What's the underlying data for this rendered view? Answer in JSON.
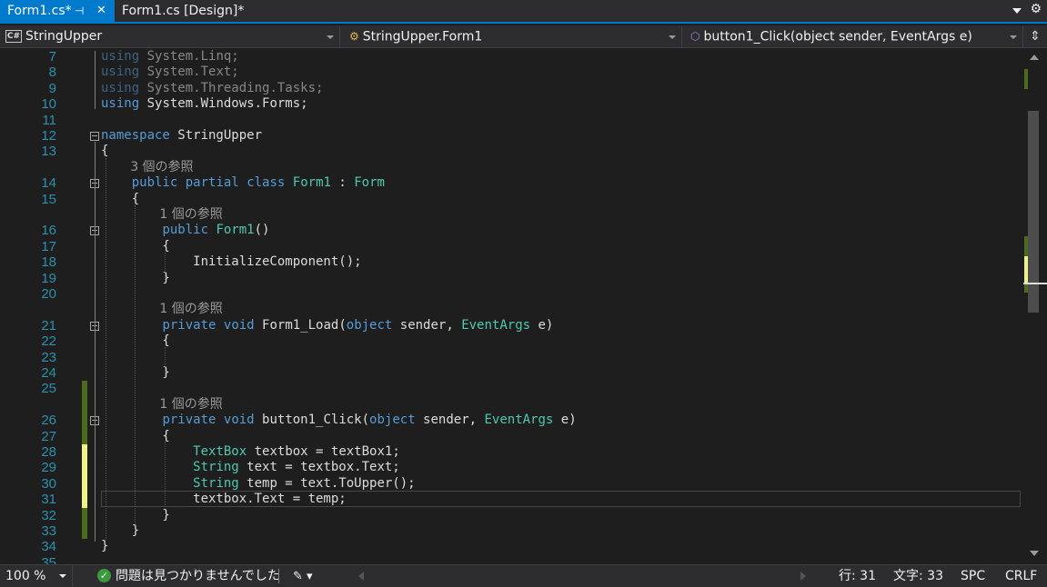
{
  "tabs": [
    {
      "label": "Form1.cs*",
      "active": true
    },
    {
      "label": "Form1.cs [Design]*",
      "active": false
    }
  ],
  "tab_icons": {
    "pin": "pin-icon",
    "close": "close-icon",
    "menu": "chevron-down-icon",
    "settings": "gear-icon"
  },
  "navbar": {
    "project": "StringUpper",
    "project_icon_text": "C#",
    "type": "StringUpper.Form1",
    "member": "button1_Click(object sender, EventArgs e)"
  },
  "editor": {
    "lines": [
      {
        "n": "7",
        "tokens": [
          [
            "kw",
            "using"
          ],
          [
            "tx",
            " System.Linq;"
          ]
        ],
        "dim": true
      },
      {
        "n": "8",
        "tokens": [
          [
            "kw",
            "using"
          ],
          [
            "tx",
            " System.Text;"
          ]
        ],
        "dim": true
      },
      {
        "n": "9",
        "tokens": [
          [
            "kw",
            "using"
          ],
          [
            "tx",
            " System.Threading.Tasks;"
          ]
        ],
        "dim": true
      },
      {
        "n": "10",
        "tokens": [
          [
            "kw",
            "using"
          ],
          [
            "tx",
            " System.Windows.Forms;"
          ]
        ]
      },
      {
        "n": "11",
        "tokens": []
      },
      {
        "n": "12",
        "tokens": [
          [
            "kw",
            "namespace"
          ],
          [
            "tx",
            " StringUpper"
          ]
        ],
        "fold": true
      },
      {
        "n": "13",
        "tokens": [
          [
            "tx",
            "{"
          ]
        ]
      },
      {
        "lens": "3 個の参照",
        "indent": 4
      },
      {
        "n": "14",
        "tokens": [
          [
            "tx",
            "    "
          ],
          [
            "kw",
            "public"
          ],
          [
            "tx",
            " "
          ],
          [
            "kw",
            "partial"
          ],
          [
            "tx",
            " "
          ],
          [
            "kw",
            "class"
          ],
          [
            "tx",
            " "
          ],
          [
            "ty",
            "Form1"
          ],
          [
            "tx",
            " : "
          ],
          [
            "ty",
            "Form"
          ]
        ],
        "fold": true
      },
      {
        "n": "15",
        "tokens": [
          [
            "tx",
            "    {"
          ]
        ]
      },
      {
        "lens": "1 個の参照",
        "indent": 8
      },
      {
        "n": "16",
        "tokens": [
          [
            "tx",
            "        "
          ],
          [
            "kw",
            "public"
          ],
          [
            "tx",
            " "
          ],
          [
            "ty",
            "Form1"
          ],
          [
            "tx",
            "()"
          ]
        ],
        "fold": true
      },
      {
        "n": "17",
        "tokens": [
          [
            "tx",
            "        {"
          ]
        ]
      },
      {
        "n": "18",
        "tokens": [
          [
            "tx",
            "            InitializeComponent();"
          ]
        ]
      },
      {
        "n": "19",
        "tokens": [
          [
            "tx",
            "        }"
          ]
        ]
      },
      {
        "n": "20",
        "tokens": []
      },
      {
        "lens": "1 個の参照",
        "indent": 8
      },
      {
        "n": "21",
        "tokens": [
          [
            "tx",
            "        "
          ],
          [
            "kw",
            "private"
          ],
          [
            "tx",
            " "
          ],
          [
            "kw",
            "void"
          ],
          [
            "tx",
            " Form1_Load("
          ],
          [
            "kw",
            "object"
          ],
          [
            "tx",
            " sender, "
          ],
          [
            "ty",
            "EventArgs"
          ],
          [
            "tx",
            " e)"
          ]
        ],
        "fold": true
      },
      {
        "n": "22",
        "tokens": [
          [
            "tx",
            "        {"
          ]
        ]
      },
      {
        "n": "23",
        "tokens": []
      },
      {
        "n": "24",
        "tokens": [
          [
            "tx",
            "        }"
          ]
        ]
      },
      {
        "n": "25",
        "tokens": [],
        "change": "green"
      },
      {
        "lens": "1 個の参照",
        "indent": 8,
        "change": "green"
      },
      {
        "n": "26",
        "tokens": [
          [
            "tx",
            "        "
          ],
          [
            "kw",
            "private"
          ],
          [
            "tx",
            " "
          ],
          [
            "kw",
            "void"
          ],
          [
            "tx",
            " button1_Click("
          ],
          [
            "kw",
            "object"
          ],
          [
            "tx",
            " sender, "
          ],
          [
            "ty",
            "EventArgs"
          ],
          [
            "tx",
            " e)"
          ]
        ],
        "fold": true,
        "change": "green"
      },
      {
        "n": "27",
        "tokens": [
          [
            "tx",
            "        {"
          ]
        ],
        "change": "green"
      },
      {
        "n": "28",
        "tokens": [
          [
            "tx",
            "            "
          ],
          [
            "ty",
            "TextBox"
          ],
          [
            "tx",
            " textbox = textBox1;"
          ]
        ],
        "change": "yellow"
      },
      {
        "n": "29",
        "tokens": [
          [
            "tx",
            "            "
          ],
          [
            "ty",
            "String"
          ],
          [
            "tx",
            " text = textbox.Text;"
          ]
        ],
        "change": "yellow"
      },
      {
        "n": "30",
        "tokens": [
          [
            "tx",
            "            "
          ],
          [
            "ty",
            "String"
          ],
          [
            "tx",
            " temp = text.ToUpper();"
          ]
        ],
        "change": "yellow"
      },
      {
        "n": "31",
        "tokens": [
          [
            "tx",
            "            textbox.Text = temp;"
          ]
        ],
        "change": "yellow",
        "current": true
      },
      {
        "n": "32",
        "tokens": [
          [
            "tx",
            "        }"
          ]
        ],
        "change": "green"
      },
      {
        "n": "33",
        "tokens": [
          [
            "tx",
            "    }"
          ]
        ],
        "change": "green"
      },
      {
        "n": "34",
        "tokens": [
          [
            "tx",
            "}"
          ]
        ]
      },
      {
        "n": "35",
        "tokens": []
      }
    ]
  },
  "statusbar": {
    "zoom": "100 %",
    "issues": "問題は見つかりませんでした",
    "line": "行: 31",
    "col": "文字: 33",
    "spc": "SPC",
    "eol": "CRLF"
  },
  "colors": {
    "accent": "#007acc",
    "keyword": "#569cd6",
    "type": "#4ec9b0",
    "line_number": "#2b91af",
    "change_saved": "#4e6a1f",
    "change_unsaved": "#eff28a"
  }
}
